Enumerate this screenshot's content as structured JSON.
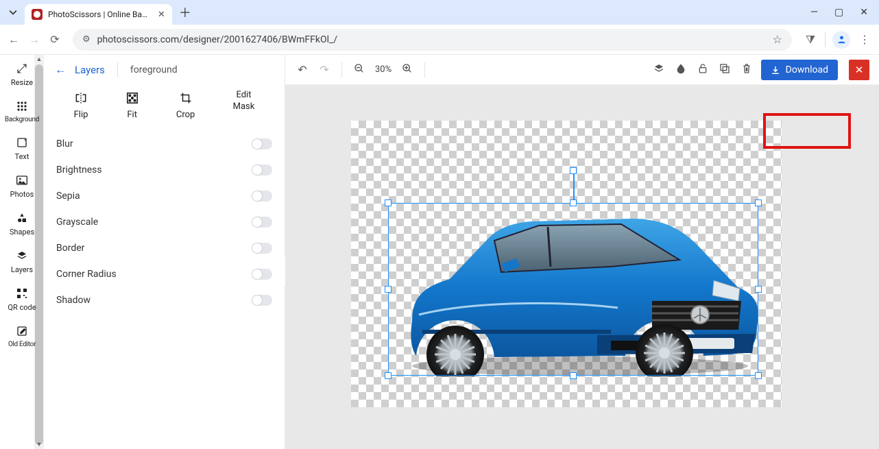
{
  "browser": {
    "tab_title": "PhotoScissors | Online Backgro",
    "url": "photoscissors.com/designer/2001627406/BWmFFkOl_/"
  },
  "leftbar": {
    "items": [
      {
        "label": "Resize"
      },
      {
        "label": "Background"
      },
      {
        "label": "Text"
      },
      {
        "label": "Photos"
      },
      {
        "label": "Shapes"
      },
      {
        "label": "Layers"
      },
      {
        "label": "QR code"
      },
      {
        "label": "Old Editor"
      }
    ]
  },
  "panel": {
    "back_label": "Layers",
    "layer_name": "foreground",
    "tools": {
      "flip": "Flip",
      "fit": "Fit",
      "crop": "Crop",
      "editmask_line1": "Edit",
      "editmask_line2": "Mask"
    },
    "props": [
      {
        "label": "Blur"
      },
      {
        "label": "Brightness"
      },
      {
        "label": "Sepia"
      },
      {
        "label": "Grayscale"
      },
      {
        "label": "Border"
      },
      {
        "label": "Corner Radius"
      },
      {
        "label": "Shadow"
      }
    ]
  },
  "toolbar": {
    "zoom_pct": "30%",
    "download_label": "Download"
  }
}
